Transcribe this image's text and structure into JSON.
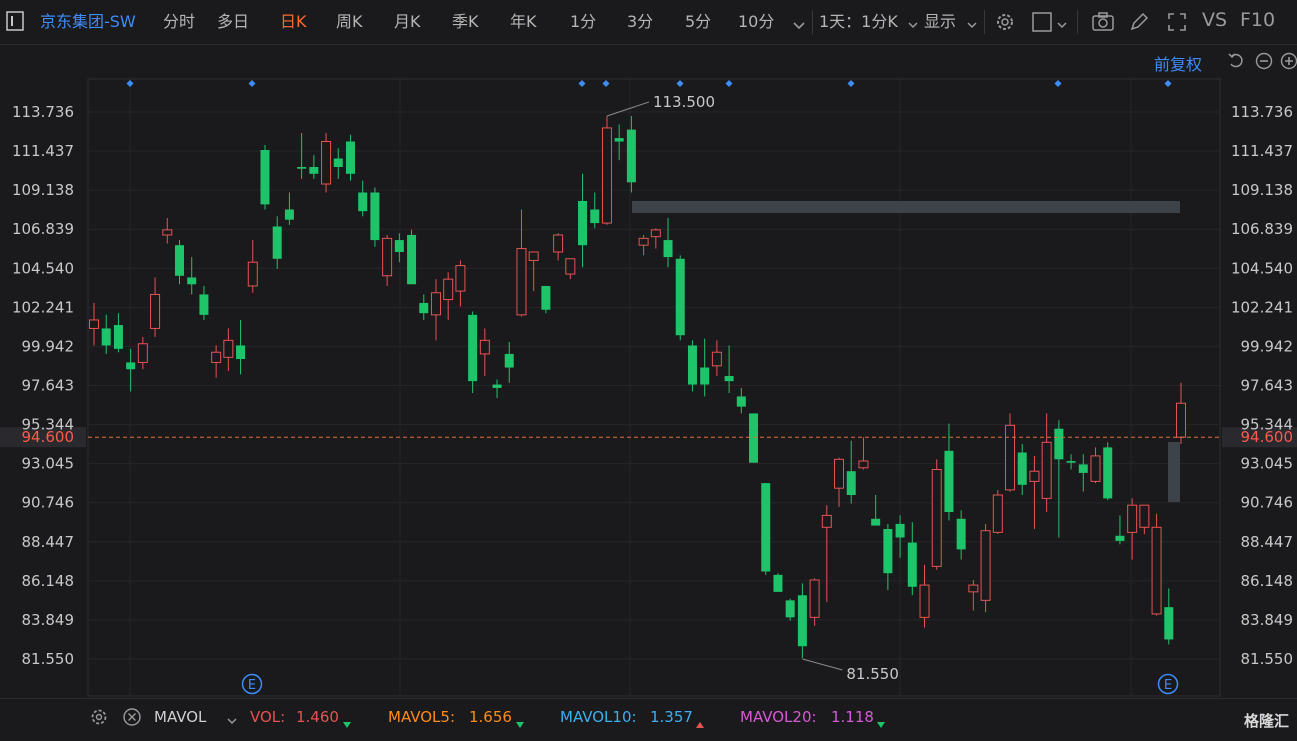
{
  "toolbar": {
    "stock_name": "京东集团-SW",
    "periods": [
      "分时",
      "多日",
      "日K",
      "周K",
      "月K",
      "季K",
      "年K",
      "1分",
      "3分",
      "5分",
      "10分"
    ],
    "active_period": "日K",
    "range_select": "1天：1分K",
    "display_label": "显示",
    "vs_label": "VS",
    "f10_label": "F10"
  },
  "adjust_label": "前复权",
  "price_axis": {
    "ticks": [
      "113.736",
      "111.437",
      "109.138",
      "106.839",
      "104.540",
      "102.241",
      "99.942",
      "97.643",
      "95.344",
      "93.045",
      "90.746",
      "88.447",
      "86.148",
      "83.849",
      "81.550"
    ],
    "current_price": "94.600"
  },
  "annotations": {
    "high_label": "113.500",
    "low_label": "81.550",
    "event_marker": "E"
  },
  "indicator_bar": {
    "name": "MAVOL",
    "vol_label": "VOL:",
    "vol_value": "1.460",
    "mavol5_label": "MAVOL5:",
    "mavol5_value": "1.656",
    "mavol10_label": "MAVOL10:",
    "mavol10_value": "1.357",
    "mavol20_label": "MAVOL20:",
    "mavol20_value": "1.118"
  },
  "watermark": "格隆汇",
  "colors": {
    "up": "#e55353",
    "down": "#1fc46a",
    "accent": "#ff6a2c",
    "link": "#3d8cf7",
    "mavol5": "#ff8c1a",
    "mavol10": "#3db0f0",
    "mavol20": "#d65ad6"
  },
  "chart_data": {
    "type": "candlestick",
    "y_min": 81.55,
    "y_max": 113.736,
    "candles": [
      {
        "o": 101.0,
        "h": 102.5,
        "l": 100.0,
        "c": 101.5
      },
      {
        "o": 101.0,
        "h": 101.8,
        "l": 99.5,
        "c": 100.0
      },
      {
        "o": 101.2,
        "h": 101.9,
        "l": 99.6,
        "c": 99.8
      },
      {
        "o": 99.0,
        "h": 99.8,
        "l": 97.3,
        "c": 98.6
      },
      {
        "o": 99.0,
        "h": 100.5,
        "l": 98.6,
        "c": 100.1
      },
      {
        "o": 101.0,
        "h": 104.0,
        "l": 100.5,
        "c": 103.0
      },
      {
        "o": 106.5,
        "h": 107.5,
        "l": 106.0,
        "c": 106.8
      },
      {
        "o": 105.9,
        "h": 106.2,
        "l": 103.6,
        "c": 104.1
      },
      {
        "o": 104.0,
        "h": 105.2,
        "l": 103.0,
        "c": 103.6
      },
      {
        "o": 103.0,
        "h": 103.5,
        "l": 101.5,
        "c": 101.8
      },
      {
        "o": 99.0,
        "h": 100.0,
        "l": 98.1,
        "c": 99.6
      },
      {
        "o": 99.3,
        "h": 101.0,
        "l": 98.5,
        "c": 100.3
      },
      {
        "o": 100.0,
        "h": 101.5,
        "l": 98.3,
        "c": 99.2
      },
      {
        "o": 103.5,
        "h": 106.2,
        "l": 103.1,
        "c": 104.9
      },
      {
        "o": 111.5,
        "h": 111.8,
        "l": 108.0,
        "c": 108.3
      },
      {
        "o": 107.0,
        "h": 107.6,
        "l": 104.5,
        "c": 105.1
      },
      {
        "o": 108.0,
        "h": 109.0,
        "l": 107.1,
        "c": 107.4
      },
      {
        "o": 110.5,
        "h": 112.5,
        "l": 109.8,
        "c": 110.4
      },
      {
        "o": 110.5,
        "h": 111.2,
        "l": 109.8,
        "c": 110.1
      },
      {
        "o": 109.5,
        "h": 112.5,
        "l": 109.0,
        "c": 112.0
      },
      {
        "o": 111.0,
        "h": 111.6,
        "l": 109.8,
        "c": 110.5
      },
      {
        "o": 112.0,
        "h": 112.4,
        "l": 109.7,
        "c": 110.1
      },
      {
        "o": 109.0,
        "h": 109.7,
        "l": 107.6,
        "c": 107.9
      },
      {
        "o": 109.0,
        "h": 109.3,
        "l": 105.8,
        "c": 106.2
      },
      {
        "o": 104.1,
        "h": 106.5,
        "l": 103.5,
        "c": 106.3
      },
      {
        "o": 106.2,
        "h": 106.6,
        "l": 104.9,
        "c": 105.5
      },
      {
        "o": 106.5,
        "h": 106.8,
        "l": 103.6,
        "c": 103.6
      },
      {
        "o": 102.5,
        "h": 103.0,
        "l": 101.5,
        "c": 101.9
      },
      {
        "o": 101.8,
        "h": 103.9,
        "l": 100.3,
        "c": 103.1
      },
      {
        "o": 102.7,
        "h": 104.3,
        "l": 101.5,
        "c": 103.9
      },
      {
        "o": 103.2,
        "h": 105.0,
        "l": 102.3,
        "c": 104.7
      },
      {
        "o": 101.8,
        "h": 102.0,
        "l": 97.2,
        "c": 97.9
      },
      {
        "o": 99.5,
        "h": 101.0,
        "l": 98.2,
        "c": 100.3
      },
      {
        "o": 97.7,
        "h": 98.0,
        "l": 96.9,
        "c": 97.5
      },
      {
        "o": 99.5,
        "h": 100.2,
        "l": 97.8,
        "c": 98.7
      },
      {
        "o": 101.8,
        "h": 108.0,
        "l": 101.7,
        "c": 105.7
      },
      {
        "o": 105.0,
        "h": 105.5,
        "l": 103.2,
        "c": 105.5
      },
      {
        "o": 103.5,
        "h": 103.5,
        "l": 101.9,
        "c": 102.1
      },
      {
        "o": 105.5,
        "h": 106.6,
        "l": 105.0,
        "c": 106.5
      },
      {
        "o": 104.2,
        "h": 105.1,
        "l": 103.9,
        "c": 105.1
      },
      {
        "o": 108.5,
        "h": 110.1,
        "l": 104.6,
        "c": 105.9
      },
      {
        "o": 108.0,
        "h": 109.0,
        "l": 106.9,
        "c": 107.2
      },
      {
        "o": 107.2,
        "h": 113.5,
        "l": 107.1,
        "c": 112.8
      },
      {
        "o": 112.2,
        "h": 113.0,
        "l": 110.9,
        "c": 112.0
      },
      {
        "o": 112.7,
        "h": 113.5,
        "l": 109.0,
        "c": 109.6
      },
      {
        "o": 105.9,
        "h": 106.5,
        "l": 105.3,
        "c": 106.3
      },
      {
        "o": 106.4,
        "h": 106.9,
        "l": 105.7,
        "c": 106.8
      },
      {
        "o": 106.2,
        "h": 107.5,
        "l": 104.6,
        "c": 105.2
      },
      {
        "o": 105.1,
        "h": 105.3,
        "l": 100.3,
        "c": 100.6
      },
      {
        "o": 100.0,
        "h": 100.3,
        "l": 97.3,
        "c": 97.7
      },
      {
        "o": 98.7,
        "h": 100.4,
        "l": 97.0,
        "c": 97.7
      },
      {
        "o": 98.8,
        "h": 100.3,
        "l": 98.2,
        "c": 99.6
      },
      {
        "o": 98.2,
        "h": 100.0,
        "l": 97.2,
        "c": 97.9
      },
      {
        "o": 97.0,
        "h": 97.5,
        "l": 96.0,
        "c": 96.4
      },
      {
        "o": 96.0,
        "h": 96.0,
        "l": 93.1,
        "c": 93.1
      },
      {
        "o": 91.9,
        "h": 91.9,
        "l": 86.5,
        "c": 86.7
      },
      {
        "o": 86.5,
        "h": 86.6,
        "l": 85.5,
        "c": 85.5
      },
      {
        "o": 85.0,
        "h": 85.1,
        "l": 83.8,
        "c": 84.0
      },
      {
        "o": 85.3,
        "h": 86.0,
        "l": 81.6,
        "c": 82.3
      },
      {
        "o": 84.0,
        "h": 86.3,
        "l": 83.5,
        "c": 86.2
      },
      {
        "o": 89.3,
        "h": 90.6,
        "l": 84.9,
        "c": 90.0
      },
      {
        "o": 91.6,
        "h": 93.4,
        "l": 90.5,
        "c": 93.3
      },
      {
        "o": 92.6,
        "h": 94.4,
        "l": 90.7,
        "c": 91.2
      },
      {
        "o": 92.8,
        "h": 94.6,
        "l": 92.7,
        "c": 93.2
      },
      {
        "o": 89.8,
        "h": 91.2,
        "l": 89.5,
        "c": 89.4
      },
      {
        "o": 89.2,
        "h": 89.5,
        "l": 85.6,
        "c": 86.6
      },
      {
        "o": 89.5,
        "h": 90.0,
        "l": 87.5,
        "c": 88.7
      },
      {
        "o": 88.4,
        "h": 89.6,
        "l": 85.3,
        "c": 85.8
      },
      {
        "o": 84.0,
        "h": 87.1,
        "l": 83.4,
        "c": 85.9
      },
      {
        "o": 87.0,
        "h": 93.3,
        "l": 86.8,
        "c": 92.7
      },
      {
        "o": 93.8,
        "h": 95.4,
        "l": 89.7,
        "c": 90.2
      },
      {
        "o": 89.8,
        "h": 90.3,
        "l": 87.4,
        "c": 88.0
      },
      {
        "o": 85.5,
        "h": 86.2,
        "l": 84.4,
        "c": 85.9
      },
      {
        "o": 85.0,
        "h": 89.5,
        "l": 84.3,
        "c": 89.1
      },
      {
        "o": 89.0,
        "h": 91.5,
        "l": 88.9,
        "c": 91.2
      },
      {
        "o": 91.5,
        "h": 96.0,
        "l": 91.4,
        "c": 95.3
      },
      {
        "o": 93.7,
        "h": 94.2,
        "l": 91.2,
        "c": 91.8
      },
      {
        "o": 92.0,
        "h": 93.5,
        "l": 89.2,
        "c": 92.6
      },
      {
        "o": 91.0,
        "h": 96.0,
        "l": 90.2,
        "c": 94.3
      },
      {
        "o": 95.1,
        "h": 95.6,
        "l": 88.7,
        "c": 93.3
      },
      {
        "o": 93.2,
        "h": 93.6,
        "l": 92.7,
        "c": 93.1
      },
      {
        "o": 93.0,
        "h": 93.6,
        "l": 91.4,
        "c": 92.5
      },
      {
        "o": 92.0,
        "h": 94.0,
        "l": 91.9,
        "c": 93.5
      },
      {
        "o": 94.0,
        "h": 94.3,
        "l": 90.9,
        "c": 91.0
      },
      {
        "o": 88.8,
        "h": 90.0,
        "l": 88.3,
        "c": 88.5
      },
      {
        "o": 89.0,
        "h": 91.0,
        "l": 87.4,
        "c": 90.6
      },
      {
        "o": 89.3,
        "h": 90.6,
        "l": 88.9,
        "c": 90.6
      },
      {
        "o": 84.2,
        "h": 90.1,
        "l": 84.1,
        "c": 89.3
      },
      {
        "o": 84.6,
        "h": 85.7,
        "l": 82.4,
        "c": 82.7
      },
      {
        "o": 94.6,
        "h": 97.8,
        "l": 94.2,
        "c": 96.6
      }
    ]
  }
}
